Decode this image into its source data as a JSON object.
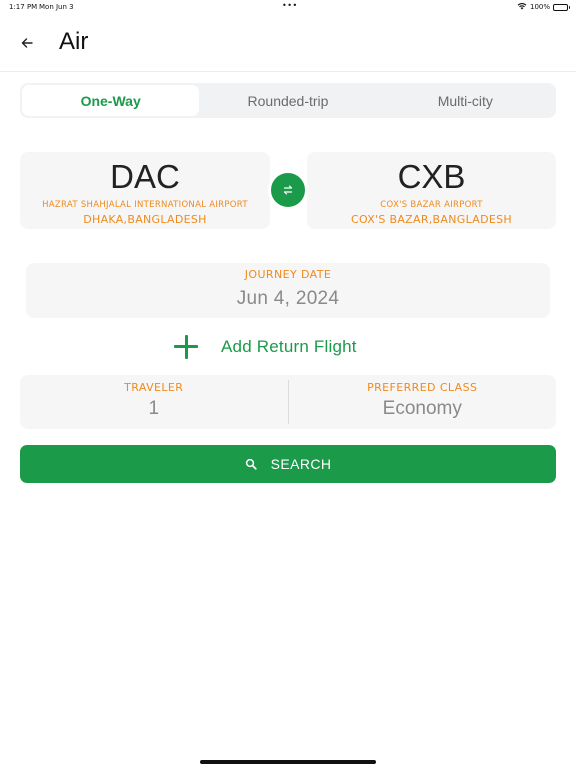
{
  "status_bar": {
    "time": "1:17 PM",
    "date": "Mon Jun 3",
    "dots": "•••",
    "battery": "100%"
  },
  "header": {
    "title": "Air",
    "back_icon": "arrow-left-icon"
  },
  "trip_tabs": [
    {
      "label": "One-Way",
      "active": true
    },
    {
      "label": "Rounded-trip",
      "active": false
    },
    {
      "label": "Multi-city",
      "active": false
    }
  ],
  "from": {
    "code": "DAC",
    "airport": "HAZRAT SHAHJALAL INTERNATIONAL AIRPORT",
    "city": "DHAKA,BANGLADESH"
  },
  "to": {
    "code": "CXB",
    "airport": "COX'S BAZAR AIRPORT",
    "city": "COX'S BAZAR,BANGLADESH"
  },
  "swap_icon": "swap-arrows-icon",
  "journey": {
    "label": "JOURNEY DATE",
    "value": "Jun 4, 2024"
  },
  "add_return": {
    "label": "Add Return Flight"
  },
  "traveler": {
    "label": "TRAVELER",
    "value": "1"
  },
  "preferred_class": {
    "label": "PREFERRED CLASS",
    "value": "Economy"
  },
  "search": {
    "label": "SEARCH"
  },
  "colors": {
    "accent": "#1b9a4a",
    "label_orange": "#f08a1c",
    "card_bg": "#f6f6f7"
  }
}
